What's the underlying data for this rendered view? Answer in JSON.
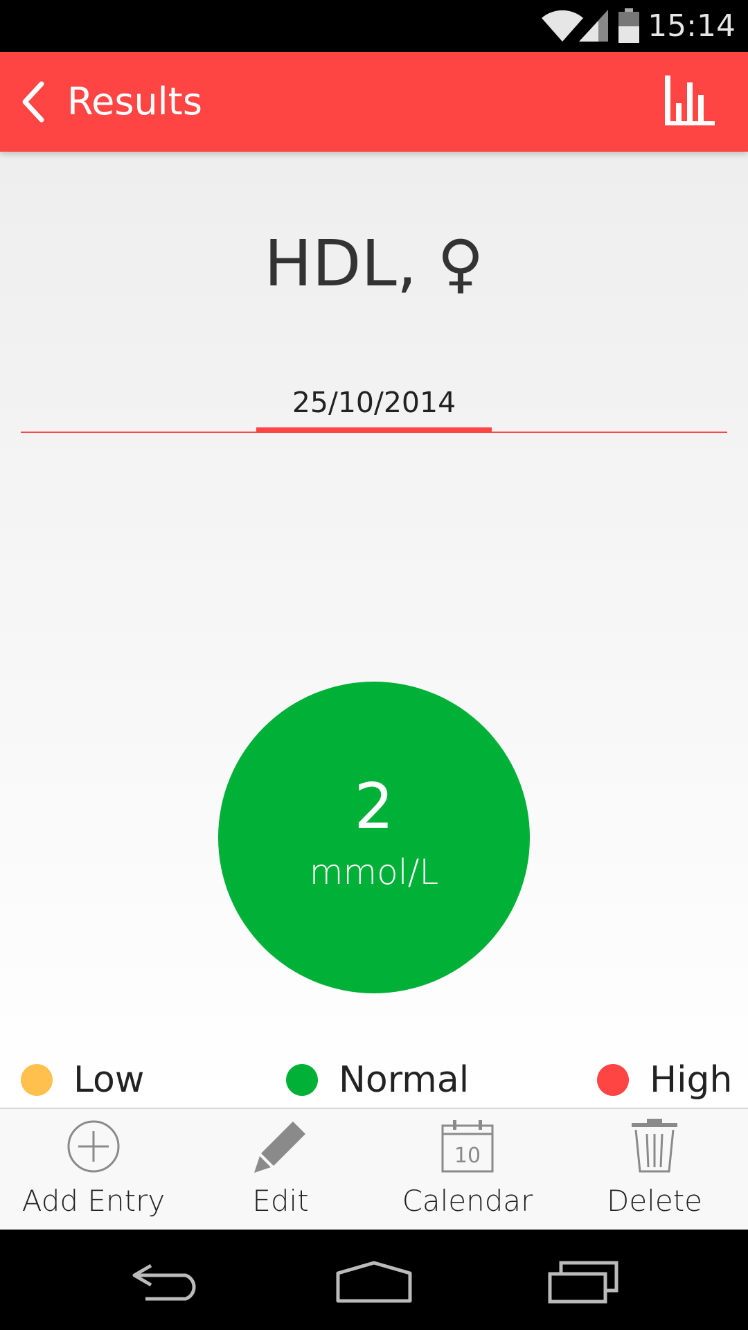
{
  "status_bar": {
    "time": "15:14",
    "icons": [
      "wifi-icon",
      "signal-icon",
      "battery-icon"
    ]
  },
  "app_bar": {
    "title": "Results",
    "back_icon": "chevron-left-icon",
    "action_icon": "bar-chart-icon",
    "color": "#ff4444"
  },
  "result": {
    "test_name": "HDL, ♀",
    "date": "25/10/2014",
    "value": "2",
    "unit": "mmol/L",
    "status": "Normal",
    "status_color": "#00b037"
  },
  "legend": [
    {
      "label": "Low",
      "color": "#ffc04d"
    },
    {
      "label": "Normal",
      "color": "#00b037"
    },
    {
      "label": "High",
      "color": "#ff4444"
    }
  ],
  "toolbar": {
    "items": [
      {
        "label": "Add Entry",
        "icon": "add-circle-icon"
      },
      {
        "label": "Edit",
        "icon": "pencil-icon"
      },
      {
        "label": "Calendar",
        "icon": "calendar-icon",
        "day": "10"
      },
      {
        "label": "Delete",
        "icon": "trash-icon"
      }
    ]
  },
  "nav_bar": {
    "icons": [
      "back-nav-icon",
      "home-nav-icon",
      "recents-nav-icon"
    ]
  }
}
